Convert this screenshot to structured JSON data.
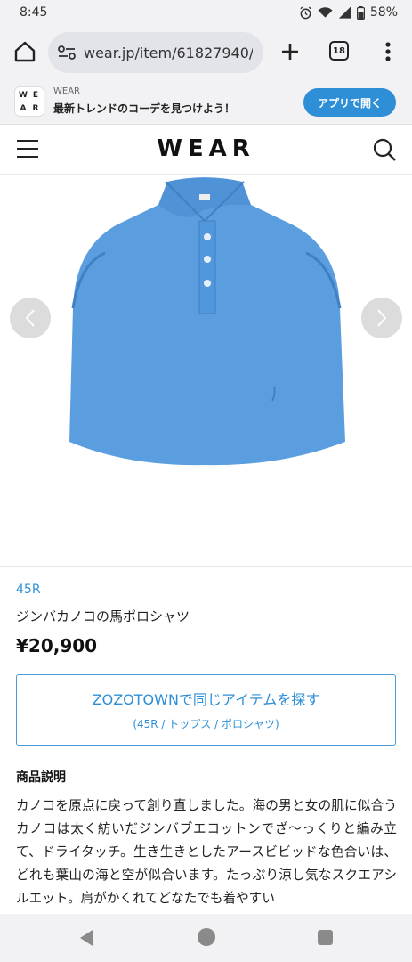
{
  "status_bar": {
    "time": "8:45",
    "battery": "58%"
  },
  "browser": {
    "url": "wear.jp/item/61827940/",
    "tab_count": "18"
  },
  "app_banner": {
    "logo_letters": [
      "W",
      "E",
      "A",
      "R"
    ],
    "app_name": "WEAR",
    "tagline": "最新トレンドのコーデを見つけよう！",
    "open_button": "アプリで開く"
  },
  "header": {
    "logo": "WEAR"
  },
  "product": {
    "brand": "45R",
    "name": "ジンバカノコの馬ポロシャツ",
    "price": "¥20,900",
    "image_color": "#5b9ee0"
  },
  "zozo_button": {
    "label": "ZOZOTOWNで同じアイテムを探す",
    "sublabel": "(45R / トップス / ポロシャツ)"
  },
  "description": {
    "heading": "商品説明",
    "body": "カノコを原点に戻って創り直しました。海の男と女の肌に似合うカノコは太く紡いだジンバブエコットンでざ〜っくりと編み立て、ドライタッチ。生き生きとしたアースビビッドな色合いは、どれも葉山の海と空が似合います。たっぷり涼し気なスクエアシルエット。肩がかくれてどなたでも着やすい"
  },
  "colors": {
    "accent": "#2f8fd6",
    "chrome": "#f2f2f4"
  }
}
